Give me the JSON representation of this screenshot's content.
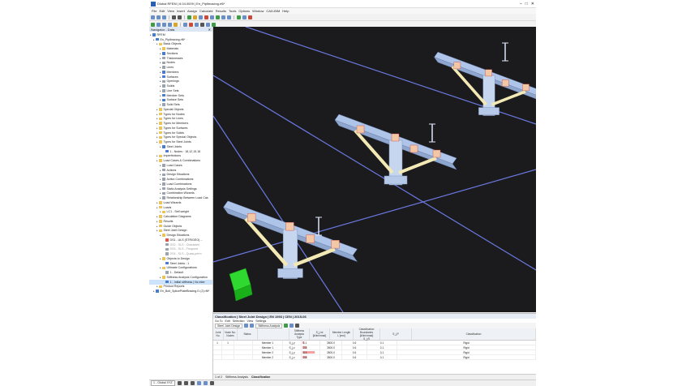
{
  "window": {
    "title": "Dlubal RFEM | 6.04.0009 | En_Pipltmacing.rf6*"
  },
  "menu": [
    "File",
    "Edit",
    "View",
    "Insert",
    "Assign",
    "Calculate",
    "Results",
    "Tools",
    "Options",
    "Window",
    "CAD-BIM",
    "Help"
  ],
  "navigator": {
    "title": "Navigator - Data",
    "tree": [
      {
        "label": "RFEM",
        "level": 0,
        "icon": "model-icon",
        "color": "blue"
      },
      {
        "label": "En_Piplbracing.rf6*",
        "level": 1,
        "icon": "file-icon",
        "color": "blue"
      },
      {
        "label": "Basic Objects",
        "level": 2,
        "icon": "folder-icon",
        "color": "yellow"
      },
      {
        "label": "Materials",
        "level": 3,
        "icon": "materials-icon",
        "color": "yellow"
      },
      {
        "label": "Sections",
        "level": 3,
        "icon": "sections-icon",
        "color": "blue"
      },
      {
        "label": "Thicknesses",
        "level": 3,
        "icon": "thickness-icon",
        "color": "gray"
      },
      {
        "label": "Nodes",
        "level": 3,
        "icon": "nodes-icon",
        "color": "gray"
      },
      {
        "label": "Lines",
        "level": 3,
        "icon": "lines-icon",
        "color": "gray"
      },
      {
        "label": "Members",
        "level": 3,
        "icon": "members-icon",
        "color": "blue"
      },
      {
        "label": "Surfaces",
        "level": 3,
        "icon": "surfaces-icon",
        "color": "blue"
      },
      {
        "label": "Openings",
        "level": 3,
        "icon": "openings-icon",
        "color": "gray"
      },
      {
        "label": "Solids",
        "level": 3,
        "icon": "solids-icon",
        "color": "gray"
      },
      {
        "label": "Line Sets",
        "level": 3,
        "icon": "linesets-icon",
        "color": "gray"
      },
      {
        "label": "Member Sets",
        "level": 3,
        "icon": "membersets-icon",
        "color": "blue"
      },
      {
        "label": "Surface Sets",
        "level": 3,
        "icon": "surfacesets-icon",
        "color": "blue"
      },
      {
        "label": "Solid Sets",
        "level": 3,
        "icon": "solidsets-icon",
        "color": "gray"
      },
      {
        "label": "Special Objects",
        "level": 2,
        "icon": "folder-icon",
        "color": "yellow"
      },
      {
        "label": "Types for Nodes",
        "level": 2,
        "icon": "folder-icon",
        "color": "yellow"
      },
      {
        "label": "Types for Lines",
        "level": 2,
        "icon": "folder-icon",
        "color": "yellow"
      },
      {
        "label": "Types for Members",
        "level": 2,
        "icon": "folder-icon",
        "color": "yellow"
      },
      {
        "label": "Types for Surfaces",
        "level": 2,
        "icon": "folder-icon",
        "color": "yellow"
      },
      {
        "label": "Types for Solids",
        "level": 2,
        "icon": "folder-icon",
        "color": "yellow"
      },
      {
        "label": "Types for Special Objects",
        "level": 2,
        "icon": "folder-icon",
        "color": "yellow"
      },
      {
        "label": "Types for Steel Joints",
        "level": 2,
        "icon": "folder-icon",
        "color": "yellow"
      },
      {
        "label": "Steel Joints",
        "level": 3,
        "icon": "steel-joint-icon",
        "color": "blue"
      },
      {
        "label": "1 - Nodes : 18,12,15,18",
        "level": 4,
        "icon": "joint-item-icon",
        "color": "blue"
      },
      {
        "label": "Imperfections",
        "level": 2,
        "icon": "folder-icon",
        "color": "yellow"
      },
      {
        "label": "Load Cases & Combinations",
        "level": 2,
        "icon": "folder-icon",
        "color": "yellow"
      },
      {
        "label": "Load Cases",
        "level": 3,
        "icon": "loadcases-icon",
        "color": "gray"
      },
      {
        "label": "Actions",
        "level": 3,
        "icon": "actions-icon",
        "color": "gray"
      },
      {
        "label": "Design Situations",
        "level": 3,
        "icon": "design-situations-icon",
        "color": "gray"
      },
      {
        "label": "Action Combinations",
        "level": 3,
        "icon": "action-combinations-icon",
        "color": "gray"
      },
      {
        "label": "Load Combinations",
        "level": 3,
        "icon": "load-combinations-icon",
        "color": "gray"
      },
      {
        "label": "Static Analysis Settings",
        "level": 3,
        "icon": "settings-icon",
        "color": "gray"
      },
      {
        "label": "Combination Wizards",
        "level": 3,
        "icon": "wizard-icon",
        "color": "gray"
      },
      {
        "label": "Relationship Between Load Cas",
        "level": 3,
        "icon": "relationship-icon",
        "color": "gray"
      },
      {
        "label": "Load Wizards",
        "level": 2,
        "icon": "folder-icon",
        "color": "yellow"
      },
      {
        "label": "Loads",
        "level": 2,
        "icon": "folder-icon",
        "color": "yellow"
      },
      {
        "label": "LC1 - Self-weight",
        "level": 3,
        "icon": "loadcase-icon",
        "color": "yellow"
      },
      {
        "label": "Calculation Diagrams",
        "level": 2,
        "icon": "folder-icon",
        "color": "yellow"
      },
      {
        "label": "Results",
        "level": 2,
        "icon": "folder-icon",
        "color": "yellow"
      },
      {
        "label": "Guide Objects",
        "level": 2,
        "icon": "folder-icon",
        "color": "yellow"
      },
      {
        "label": "Steel Joint Design",
        "level": 2,
        "icon": "folder-icon",
        "color": "yellow"
      },
      {
        "label": "Design Situations",
        "level": 3,
        "icon": "folder-icon",
        "color": "yellow"
      },
      {
        "label": "DS1 - ULS (STR/GEO) ...",
        "level": 4,
        "icon": "ds-icon",
        "color": "red"
      },
      {
        "label": "DS2 - SLS - Characteri",
        "level": 4,
        "icon": "ds-icon",
        "color": "gray",
        "dim": true
      },
      {
        "label": "DS3 - SLS - Frequent",
        "level": 4,
        "icon": "ds-icon",
        "color": "gray",
        "dim": true
      },
      {
        "label": "DS4 - SLS - Quasi-perm",
        "level": 4,
        "icon": "ds-icon",
        "color": "gray",
        "dim": true
      },
      {
        "label": "Objects to Design",
        "level": 3,
        "icon": "folder-icon",
        "color": "yellow"
      },
      {
        "label": "Steel Joints : 1",
        "level": 4,
        "icon": "steel-joint-icon",
        "color": "blue"
      },
      {
        "label": "Ultimate Configurations",
        "level": 3,
        "icon": "folder-icon",
        "color": "yellow"
      },
      {
        "label": "1 - Default",
        "level": 4,
        "icon": "config-icon",
        "color": "gray"
      },
      {
        "label": "Stiffness Analysis Configuration",
        "level": 3,
        "icon": "folder-icon",
        "color": "yellow"
      },
      {
        "label": "1 - Initial stiffness | No inter",
        "level": 4,
        "icon": "config-icon",
        "color": "blue",
        "selected": true
      },
      {
        "label": "Printout Reports",
        "level": 2,
        "icon": "folder-icon",
        "color": "yellow"
      },
      {
        "label": "En_Bolt_SplicePlateBracing.f1 (2).rf6*",
        "level": 1,
        "icon": "file-icon",
        "color": "blue"
      }
    ]
  },
  "bottom_panel": {
    "title": "Classification | Steel Joint Design | EN 1993 | CEN | 2015-06",
    "menu": [
      "Go To",
      "Edit",
      "Selection",
      "View",
      "Settings"
    ],
    "selector": "Steel Joint Design",
    "analysis_selector": "Stiffness Analysis",
    "columns": {
      "joint_no": "Joint No.",
      "node_no": "Node No.",
      "nodes": "Nodes",
      "status": "Status",
      "stiffness_title": "Stiffness Analysis",
      "stiffness_type": "Type",
      "stiffness_value": "S_j,ini [kNm/mrad]",
      "member_length_title": "Member Length",
      "member_length": "L [mm]",
      "classification_title": "Classification Boundaries [kNm/mrad]",
      "s_jr": "S_j,R",
      "s_jp": "S_j,P",
      "classification": "Classification"
    },
    "rows": [
      {
        "joint": "1",
        "node": "1",
        "member": "Member 1",
        "type": "S_j,y",
        "value": "1.1",
        "fraction": 0.11,
        "length": "3500.0",
        "sjr": "0.6",
        "sjp": "0.1",
        "cls": "Rigid"
      },
      {
        "joint": "",
        "node": "",
        "member": "Member 1",
        "type": "S_j,z",
        "value": "2.8",
        "fraction": 0.28,
        "length": "3500.0",
        "sjr": "0.6",
        "sjp": "0.1",
        "cls": "Rigid"
      },
      {
        "joint": "",
        "node": "",
        "member": "Member 2",
        "type": "S_j,y",
        "value": "8.5",
        "fraction": 0.85,
        "length": "3500.0",
        "sjr": "0.6",
        "sjp": "0.1",
        "cls": "Rigid"
      },
      {
        "joint": "",
        "node": "",
        "member": "Member 2",
        "type": "S_j,z",
        "value": "2.8",
        "fraction": 0.28,
        "length": "3500.0",
        "sjr": "0.6",
        "sjp": "0.1",
        "cls": "Rigid"
      }
    ],
    "pager": "1 of 2",
    "tabs": [
      "Stiffness Analysis",
      "Classification"
    ]
  },
  "status_bar": {
    "coordinate_system": "1 - Global XYZ"
  },
  "colors": {
    "viewport_bg": "#1b1b1d",
    "beam": "#aec4e8",
    "brace": "#f3e9b4",
    "support": "#2fd92f",
    "axis_line": "#6a78e0"
  }
}
